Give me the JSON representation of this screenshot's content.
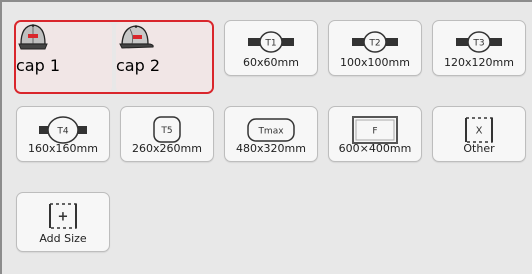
{
  "hoops": [
    {
      "id": "cap1",
      "label": "cap 1",
      "icon": "cap-front-icon",
      "selected": true
    },
    {
      "id": "cap2",
      "label": "cap 2",
      "icon": "cap-side-icon",
      "selected": true
    },
    {
      "id": "t1",
      "label": "60x60mm",
      "tag": "T1",
      "icon": "round-hoop-icon"
    },
    {
      "id": "t2",
      "label": "100x100mm",
      "tag": "T2",
      "icon": "round-hoop-icon"
    },
    {
      "id": "t3",
      "label": "120x120mm",
      "tag": "T3",
      "icon": "round-hoop-icon"
    },
    {
      "id": "t4",
      "label": "160x160mm",
      "tag": "T4",
      "icon": "round-hoop-icon"
    },
    {
      "id": "t5",
      "label": "260x260mm",
      "tag": "T5",
      "icon": "square-hoop-icon"
    },
    {
      "id": "tmax",
      "label": "480x320mm",
      "tag": "Tmax",
      "icon": "wide-hoop-icon"
    },
    {
      "id": "f",
      "label": "600×400mm",
      "tag": "F",
      "icon": "frame-hoop-icon"
    },
    {
      "id": "other",
      "label": "Other",
      "tag": "X",
      "icon": "dashed-box-icon"
    },
    {
      "id": "add",
      "label": "Add Size",
      "tag": "+",
      "icon": "add-dashed-icon"
    }
  ],
  "colors": {
    "selection_border": "#d9262c",
    "selected_fill": "#f1e6e6",
    "cap_logo": "#d9262c"
  }
}
